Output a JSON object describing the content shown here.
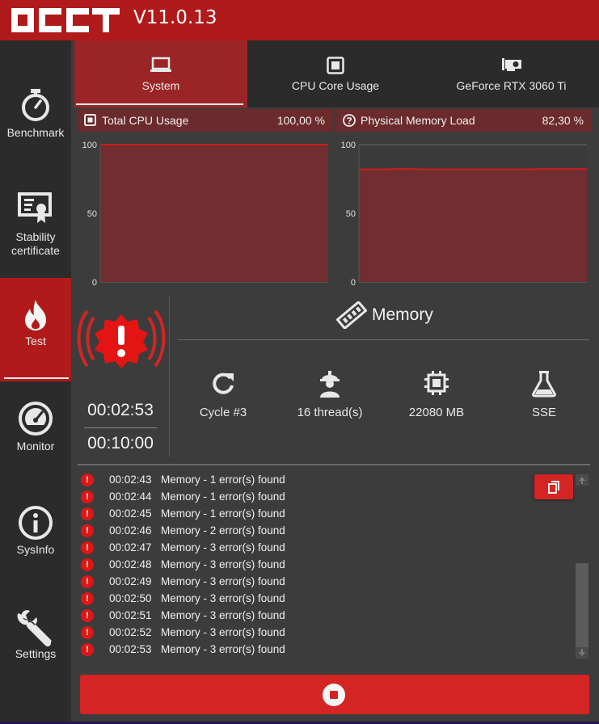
{
  "app": {
    "logo_text": "OCCT",
    "version": "V11.0.13",
    "brand_color": "#b11a1a"
  },
  "sidebar": {
    "items": [
      {
        "label": "Benchmark",
        "icon": "stopwatch-icon"
      },
      {
        "label": "Stability certificate",
        "icon": "certificate-icon"
      },
      {
        "label": "Test",
        "icon": "flame-icon",
        "active": true
      },
      {
        "label": "Monitor",
        "icon": "gauge-icon"
      },
      {
        "label": "SysInfo",
        "icon": "info-icon"
      },
      {
        "label": "Settings",
        "icon": "wrench-icon"
      }
    ]
  },
  "tabs": [
    {
      "label": "System",
      "icon": "laptop-icon",
      "active": true
    },
    {
      "label": "CPU Core Usage",
      "icon": "cpu-square-icon"
    },
    {
      "label": "GeForce RTX 3060 Ti",
      "icon": "gpu-icon"
    }
  ],
  "charts": [
    {
      "title": "Total CPU Usage",
      "value": "100,00 %",
      "icon": "cpu-square-icon"
    },
    {
      "title": "Physical Memory Load",
      "value": "82,30 %",
      "icon": "help-circle-icon"
    }
  ],
  "chart_data": [
    {
      "type": "area",
      "title": "Total CPU Usage",
      "ylim": [
        0,
        100
      ],
      "yticks": [
        "100",
        "50",
        "0"
      ],
      "x": [
        0,
        1,
        2,
        3,
        4,
        5,
        6,
        7,
        8,
        9,
        10
      ],
      "series": [
        {
          "values": [
            100,
            100,
            100,
            100,
            100,
            100,
            100,
            100,
            100,
            100,
            100
          ]
        }
      ],
      "grid": true
    },
    {
      "type": "area",
      "title": "Physical Memory Load",
      "ylim": [
        0,
        100
      ],
      "yticks": [
        "100",
        "50",
        "0"
      ],
      "x": [
        0,
        1,
        2,
        3,
        4,
        5,
        6,
        7,
        8,
        9,
        10
      ],
      "series": [
        {
          "values": [
            82.0,
            82.0,
            82.4,
            82.0,
            82.0,
            82.0,
            82.0,
            82.0,
            82.3,
            82.3,
            82.3
          ]
        }
      ],
      "grid": true
    }
  ],
  "test": {
    "elapsed": "00:02:53",
    "duration": "00:10:00",
    "status_icon": "error-badge-icon",
    "name": "Memory",
    "name_icon": "memory-stick-icon",
    "stats": [
      {
        "label": "Cycle #3",
        "icon": "refresh-icon"
      },
      {
        "label": "16 thread(s)",
        "icon": "worker-icon"
      },
      {
        "label": "22080 MB",
        "icon": "chip-icon"
      },
      {
        "label": "SSE",
        "icon": "flask-icon"
      }
    ]
  },
  "log": {
    "entries": [
      {
        "time": "00:02:43",
        "message": "Memory - 1 error(s) found"
      },
      {
        "time": "00:02:44",
        "message": "Memory - 1 error(s) found"
      },
      {
        "time": "00:02:45",
        "message": "Memory - 1 error(s) found"
      },
      {
        "time": "00:02:46",
        "message": "Memory - 2 error(s) found"
      },
      {
        "time": "00:02:47",
        "message": "Memory - 3 error(s) found"
      },
      {
        "time": "00:02:48",
        "message": "Memory - 3 error(s) found"
      },
      {
        "time": "00:02:49",
        "message": "Memory - 3 error(s) found"
      },
      {
        "time": "00:02:50",
        "message": "Memory - 3 error(s) found"
      },
      {
        "time": "00:02:51",
        "message": "Memory - 3 error(s) found"
      },
      {
        "time": "00:02:52",
        "message": "Memory - 3 error(s) found"
      },
      {
        "time": "00:02:53",
        "message": "Memory - 3 error(s) found"
      }
    ],
    "copy_icon": "copy-icon"
  },
  "stop_button": {
    "icon": "stop-icon"
  }
}
